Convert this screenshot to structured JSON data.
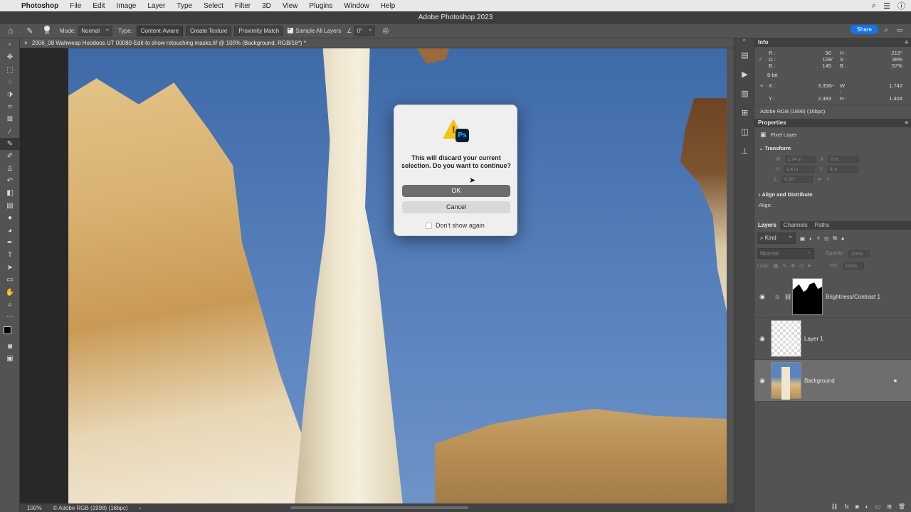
{
  "menubar": {
    "app_name": "Photoshop",
    "items": [
      "File",
      "Edit",
      "Image",
      "Layer",
      "Type",
      "Select",
      "Filter",
      "3D",
      "View",
      "Plugins",
      "Window",
      "Help"
    ]
  },
  "window": {
    "title": "Adobe Photoshop 2023"
  },
  "options": {
    "brush_size": "90",
    "mode_label": "Mode:",
    "mode_value": "Normal",
    "type_label": "Type:",
    "type_content_aware": "Content-Aware",
    "type_create_texture": "Create Texture",
    "type_proximity_match": "Proximity Match",
    "sample_all_layers": "Sample All Layers",
    "angle": "0°",
    "share": "Share"
  },
  "document": {
    "tab_title": "2006_08 Wahweap Hoodoos UT 00080-Edit-to show retouching masks.tif @ 100% (Background, RGB/16*) *"
  },
  "status": {
    "zoom": "100%",
    "profile": "Adobe RGB (1998) (16bpc)"
  },
  "info": {
    "title": "Info",
    "r": "90",
    "g": "109",
    "b": "145",
    "h": "219°",
    "s": "38%",
    "bri": "57%",
    "bit": "8-bit",
    "x": "3.358",
    "y": "2.483",
    "w": "1.742",
    "h2": "1.404",
    "profile": "Adobe RGB (1998) (16bpc)"
  },
  "properties": {
    "title": "Properties",
    "layer_type": "Pixel Layer",
    "transform_title": "Transform",
    "w_val": "1.74 in",
    "x_val": "0 in",
    "h_val": "1.4 in",
    "y_val": "0 in",
    "angle_val": "0.00°",
    "align_title": "Align and Distribute",
    "align_label": "Align:"
  },
  "layers_panel": {
    "tabs": [
      "Layers",
      "Channels",
      "Paths"
    ],
    "filter_kind": "Kind",
    "blend_mode": "Normal",
    "opacity_label": "Opacity:",
    "opacity_value": "100%",
    "lock_label": "Lock:",
    "fill_label": "Fill:",
    "fill_value": "100%",
    "layers": [
      {
        "name": "Brightness/Contrast 1"
      },
      {
        "name": "Layer 1"
      },
      {
        "name": "Background"
      }
    ]
  },
  "dialog": {
    "message": "This will discard your current selection. Do you want to continue?",
    "ok": "OK",
    "cancel": "Cancel",
    "dont_show": "Don't show again"
  }
}
